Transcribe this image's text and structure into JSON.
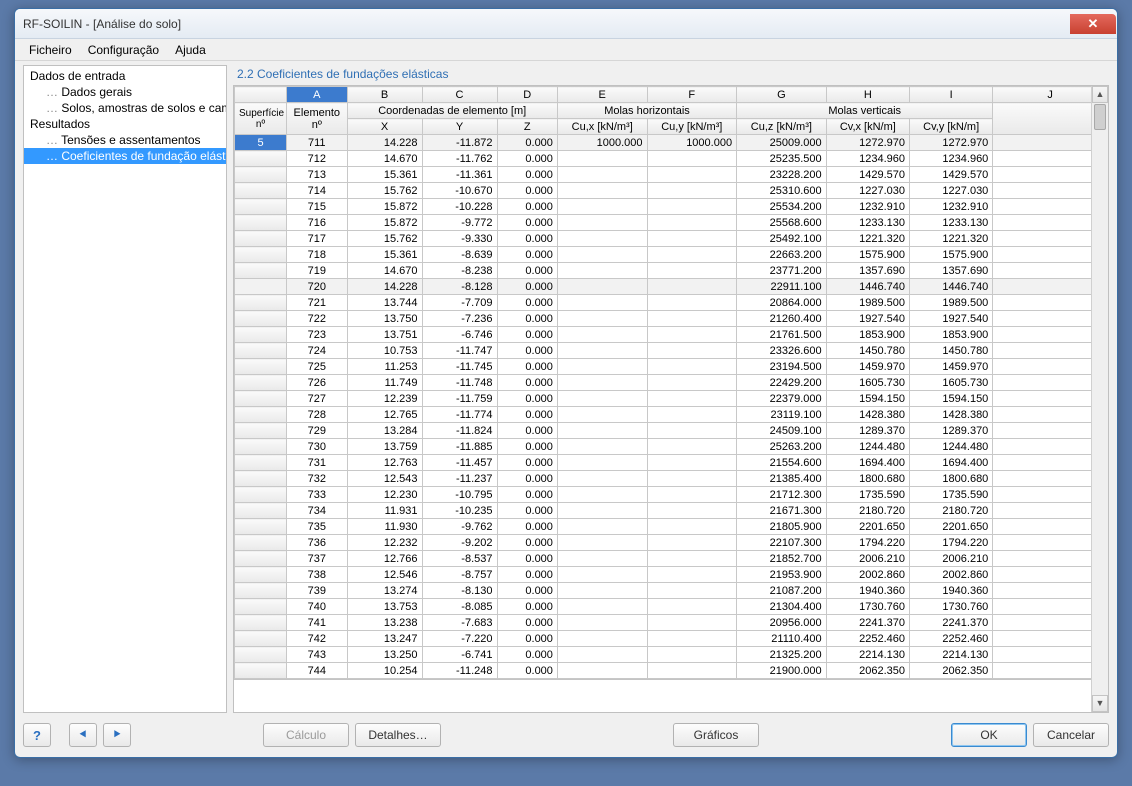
{
  "window_title": "RF-SOILIN - [Análise do solo]",
  "menus": [
    "Ficheiro",
    "Configuração",
    "Ajuda"
  ],
  "tree": {
    "g1": "Dados de entrada",
    "g1a": "Dados gerais",
    "g1b": "Solos, amostras de solos e camadas",
    "g2": "Resultados",
    "g2a": "Tensões e assentamentos",
    "g2b": "Coeficientes de fundação elástica"
  },
  "section_title": "2.2 Coeficientes de fundações elásticas",
  "col_letters": [
    "A",
    "B",
    "C",
    "D",
    "E",
    "F",
    "G",
    "H",
    "I",
    "J"
  ],
  "group_headers": {
    "surf": "Superfície",
    "elem": "Elemento",
    "coords": "Coordenadas de elemento [m]",
    "mh": "Molas horizontais",
    "mv": "Molas verticais"
  },
  "col_headers": {
    "surf": "nº",
    "elem": "nº",
    "x": "X",
    "y": "Y",
    "z": "Z",
    "cux": "Cu,x [kN/m³]",
    "cuy": "Cu,y [kN/m³]",
    "cuz": "Cu,z [kN/m³]",
    "cvx": "Cv,x [kN/m]",
    "cvy": "Cv,y [kN/m]"
  },
  "surface_no": "5",
  "rows": [
    {
      "e": "711",
      "x": "14.228",
      "y": "-11.872",
      "z": "0.000",
      "cux": "1000.000",
      "cuy": "1000.000",
      "cuz": "25009.000",
      "cvx": "1272.970",
      "cvy": "1272.970"
    },
    {
      "e": "712",
      "x": "14.670",
      "y": "-11.762",
      "z": "0.000",
      "cux": "",
      "cuy": "",
      "cuz": "25235.500",
      "cvx": "1234.960",
      "cvy": "1234.960"
    },
    {
      "e": "713",
      "x": "15.361",
      "y": "-11.361",
      "z": "0.000",
      "cux": "",
      "cuy": "",
      "cuz": "23228.200",
      "cvx": "1429.570",
      "cvy": "1429.570"
    },
    {
      "e": "714",
      "x": "15.762",
      "y": "-10.670",
      "z": "0.000",
      "cux": "",
      "cuy": "",
      "cuz": "25310.600",
      "cvx": "1227.030",
      "cvy": "1227.030"
    },
    {
      "e": "715",
      "x": "15.872",
      "y": "-10.228",
      "z": "0.000",
      "cux": "",
      "cuy": "",
      "cuz": "25534.200",
      "cvx": "1232.910",
      "cvy": "1232.910"
    },
    {
      "e": "716",
      "x": "15.872",
      "y": "-9.772",
      "z": "0.000",
      "cux": "",
      "cuy": "",
      "cuz": "25568.600",
      "cvx": "1233.130",
      "cvy": "1233.130"
    },
    {
      "e": "717",
      "x": "15.762",
      "y": "-9.330",
      "z": "0.000",
      "cux": "",
      "cuy": "",
      "cuz": "25492.100",
      "cvx": "1221.320",
      "cvy": "1221.320"
    },
    {
      "e": "718",
      "x": "15.361",
      "y": "-8.639",
      "z": "0.000",
      "cux": "",
      "cuy": "",
      "cuz": "22663.200",
      "cvx": "1575.900",
      "cvy": "1575.900"
    },
    {
      "e": "719",
      "x": "14.670",
      "y": "-8.238",
      "z": "0.000",
      "cux": "",
      "cuy": "",
      "cuz": "23771.200",
      "cvx": "1357.690",
      "cvy": "1357.690"
    },
    {
      "e": "720",
      "x": "14.228",
      "y": "-8.128",
      "z": "0.000",
      "cux": "",
      "cuy": "",
      "cuz": "22911.100",
      "cvx": "1446.740",
      "cvy": "1446.740",
      "hl": true
    },
    {
      "e": "721",
      "x": "13.744",
      "y": "-7.709",
      "z": "0.000",
      "cux": "",
      "cuy": "",
      "cuz": "20864.000",
      "cvx": "1989.500",
      "cvy": "1989.500"
    },
    {
      "e": "722",
      "x": "13.750",
      "y": "-7.236",
      "z": "0.000",
      "cux": "",
      "cuy": "",
      "cuz": "21260.400",
      "cvx": "1927.540",
      "cvy": "1927.540"
    },
    {
      "e": "723",
      "x": "13.751",
      "y": "-6.746",
      "z": "0.000",
      "cux": "",
      "cuy": "",
      "cuz": "21761.500",
      "cvx": "1853.900",
      "cvy": "1853.900"
    },
    {
      "e": "724",
      "x": "10.753",
      "y": "-11.747",
      "z": "0.000",
      "cux": "",
      "cuy": "",
      "cuz": "23326.600",
      "cvx": "1450.780",
      "cvy": "1450.780"
    },
    {
      "e": "725",
      "x": "11.253",
      "y": "-11.745",
      "z": "0.000",
      "cux": "",
      "cuy": "",
      "cuz": "23194.500",
      "cvx": "1459.970",
      "cvy": "1459.970"
    },
    {
      "e": "726",
      "x": "11.749",
      "y": "-11.748",
      "z": "0.000",
      "cux": "",
      "cuy": "",
      "cuz": "22429.200",
      "cvx": "1605.730",
      "cvy": "1605.730"
    },
    {
      "e": "727",
      "x": "12.239",
      "y": "-11.759",
      "z": "0.000",
      "cux": "",
      "cuy": "",
      "cuz": "22379.000",
      "cvx": "1594.150",
      "cvy": "1594.150"
    },
    {
      "e": "728",
      "x": "12.765",
      "y": "-11.774",
      "z": "0.000",
      "cux": "",
      "cuy": "",
      "cuz": "23119.100",
      "cvx": "1428.380",
      "cvy": "1428.380"
    },
    {
      "e": "729",
      "x": "13.284",
      "y": "-11.824",
      "z": "0.000",
      "cux": "",
      "cuy": "",
      "cuz": "24509.100",
      "cvx": "1289.370",
      "cvy": "1289.370"
    },
    {
      "e": "730",
      "x": "13.759",
      "y": "-11.885",
      "z": "0.000",
      "cux": "",
      "cuy": "",
      "cuz": "25263.200",
      "cvx": "1244.480",
      "cvy": "1244.480"
    },
    {
      "e": "731",
      "x": "12.763",
      "y": "-11.457",
      "z": "0.000",
      "cux": "",
      "cuy": "",
      "cuz": "21554.600",
      "cvx": "1694.400",
      "cvy": "1694.400"
    },
    {
      "e": "732",
      "x": "12.543",
      "y": "-11.237",
      "z": "0.000",
      "cux": "",
      "cuy": "",
      "cuz": "21385.400",
      "cvx": "1800.680",
      "cvy": "1800.680"
    },
    {
      "e": "733",
      "x": "12.230",
      "y": "-10.795",
      "z": "0.000",
      "cux": "",
      "cuy": "",
      "cuz": "21712.300",
      "cvx": "1735.590",
      "cvy": "1735.590"
    },
    {
      "e": "734",
      "x": "11.931",
      "y": "-10.235",
      "z": "0.000",
      "cux": "",
      "cuy": "",
      "cuz": "21671.300",
      "cvx": "2180.720",
      "cvy": "2180.720"
    },
    {
      "e": "735",
      "x": "11.930",
      "y": "-9.762",
      "z": "0.000",
      "cux": "",
      "cuy": "",
      "cuz": "21805.900",
      "cvx": "2201.650",
      "cvy": "2201.650"
    },
    {
      "e": "736",
      "x": "12.232",
      "y": "-9.202",
      "z": "0.000",
      "cux": "",
      "cuy": "",
      "cuz": "22107.300",
      "cvx": "1794.220",
      "cvy": "1794.220"
    },
    {
      "e": "737",
      "x": "12.766",
      "y": "-8.537",
      "z": "0.000",
      "cux": "",
      "cuy": "",
      "cuz": "21852.700",
      "cvx": "2006.210",
      "cvy": "2006.210"
    },
    {
      "e": "738",
      "x": "12.546",
      "y": "-8.757",
      "z": "0.000",
      "cux": "",
      "cuy": "",
      "cuz": "21953.900",
      "cvx": "2002.860",
      "cvy": "2002.860"
    },
    {
      "e": "739",
      "x": "13.274",
      "y": "-8.130",
      "z": "0.000",
      "cux": "",
      "cuy": "",
      "cuz": "21087.200",
      "cvx": "1940.360",
      "cvy": "1940.360"
    },
    {
      "e": "740",
      "x": "13.753",
      "y": "-8.085",
      "z": "0.000",
      "cux": "",
      "cuy": "",
      "cuz": "21304.400",
      "cvx": "1730.760",
      "cvy": "1730.760"
    },
    {
      "e": "741",
      "x": "13.238",
      "y": "-7.683",
      "z": "0.000",
      "cux": "",
      "cuy": "",
      "cuz": "20956.000",
      "cvx": "2241.370",
      "cvy": "2241.370"
    },
    {
      "e": "742",
      "x": "13.247",
      "y": "-7.220",
      "z": "0.000",
      "cux": "",
      "cuy": "",
      "cuz": "21110.400",
      "cvx": "2252.460",
      "cvy": "2252.460"
    },
    {
      "e": "743",
      "x": "13.250",
      "y": "-6.741",
      "z": "0.000",
      "cux": "",
      "cuy": "",
      "cuz": "21325.200",
      "cvx": "2214.130",
      "cvy": "2214.130"
    },
    {
      "e": "744",
      "x": "10.254",
      "y": "-11.248",
      "z": "0.000",
      "cux": "",
      "cuy": "",
      "cuz": "21900.000",
      "cvx": "2062.350",
      "cvy": "2062.350"
    }
  ],
  "buttons": {
    "calc": "Cálculo",
    "details": "Detalhes…",
    "graphics": "Gráficos",
    "ok": "OK",
    "cancel": "Cancelar"
  }
}
